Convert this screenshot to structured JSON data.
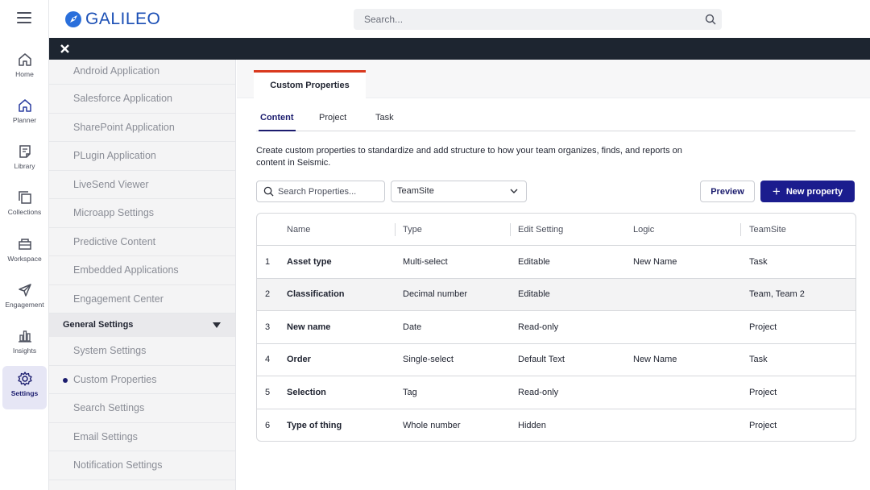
{
  "app": {
    "name": "GALILEO"
  },
  "header": {
    "search_placeholder": "Search..."
  },
  "rail": {
    "items": [
      {
        "label": "Home",
        "icon": "home-icon"
      },
      {
        "label": "Planner",
        "icon": "planner-icon"
      },
      {
        "label": "Library",
        "icon": "library-icon"
      },
      {
        "label": "Collections",
        "icon": "collections-icon"
      },
      {
        "label": "Workspace",
        "icon": "workspace-icon"
      },
      {
        "label": "Engagement",
        "icon": "engagement-icon"
      },
      {
        "label": "Insights",
        "icon": "insights-icon"
      },
      {
        "label": "Settings",
        "icon": "settings-icon",
        "active": true
      }
    ]
  },
  "settings_nav": {
    "items_top": [
      "Android Application",
      "Salesforce Application",
      "SharePoint Application",
      "PLugin Application",
      "LiveSend Viewer",
      "Microapp Settings",
      "Predictive Content",
      "Embedded Applications",
      "Engagement Center"
    ],
    "section": "General Settings",
    "items_general": [
      "System Settings",
      "Custom Properties",
      "Search Settings",
      "Email Settings",
      "Notification Settings"
    ],
    "active_item": "Custom Properties"
  },
  "page_tab": "Custom Properties",
  "subtabs": [
    "Content",
    "Project",
    "Task"
  ],
  "active_subtab": "Content",
  "description": "Create custom properties to standardize and add structure to how your team organizes, finds, and reports on content in Seismic.",
  "toolbar": {
    "search_placeholder": "Search Properties...",
    "teamsite_value": "TeamSite",
    "preview_label": "Preview",
    "new_property_label": "New property",
    "new_property_plus": "+"
  },
  "table": {
    "columns": [
      "Name",
      "Type",
      "Edit Setting",
      "Logic",
      "TeamSite"
    ],
    "rows": [
      {
        "num": "1",
        "name": "Asset type",
        "type": "Multi-select",
        "edit": "Editable",
        "logic": "New Name",
        "teamsite": "Task"
      },
      {
        "num": "2",
        "name": "Classification",
        "type": "Decimal number",
        "edit": "Editable",
        "logic": "",
        "teamsite": "Team, Team 2"
      },
      {
        "num": "3",
        "name": "New name",
        "type": "Date",
        "edit": "Read-only",
        "logic": "",
        "teamsite": "Project"
      },
      {
        "num": "4",
        "name": "Order",
        "type": "Single-select",
        "edit": "Default Text",
        "logic": "New Name",
        "teamsite": "Task"
      },
      {
        "num": "5",
        "name": "Selection",
        "type": "Tag",
        "edit": "Read-only",
        "logic": "",
        "teamsite": "Project"
      },
      {
        "num": "6",
        "name": "Type of thing",
        "type": "Whole number",
        "edit": "Hidden",
        "logic": "",
        "teamsite": "Project"
      }
    ]
  },
  "colors": {
    "accent": "#1b1c8e",
    "tab_indicator": "#d9391e",
    "dark_bar": "#1d2530",
    "logo": "#1b4fb5"
  }
}
